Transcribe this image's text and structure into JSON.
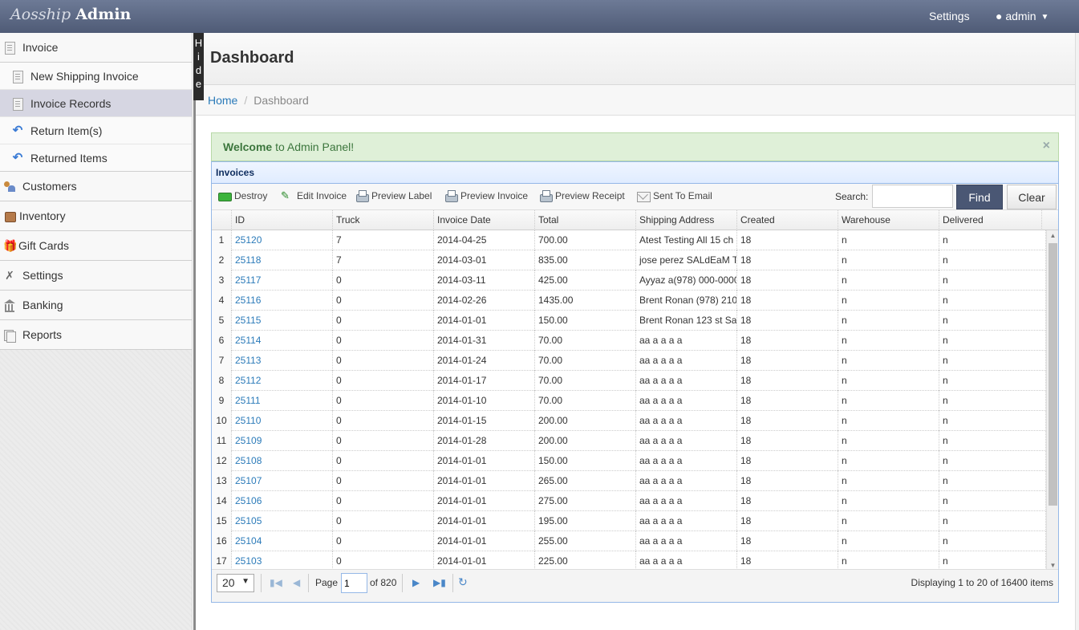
{
  "brand": {
    "part1": "Aosship",
    "part2": "Admin"
  },
  "topnav": {
    "settings": "Settings",
    "user": "admin"
  },
  "sidebar": {
    "invoice": "Invoice",
    "invoice_items": [
      {
        "label": "New Shipping Invoice",
        "icon": "new-invoice-icon"
      },
      {
        "label": "Invoice Records",
        "icon": "document-icon",
        "active": true
      },
      {
        "label": "Return Item(s)",
        "icon": "return-icon"
      },
      {
        "label": "Returned Items",
        "icon": "return-icon"
      }
    ],
    "groups": [
      {
        "label": "Customers",
        "icon": "customers-icon"
      },
      {
        "label": "Inventory",
        "icon": "inventory-icon"
      },
      {
        "label": "Gift Cards",
        "icon": "gift-icon"
      },
      {
        "label": "Settings",
        "icon": "settings-tools-icon"
      },
      {
        "label": "Banking",
        "icon": "bank-icon"
      },
      {
        "label": "Reports",
        "icon": "reports-icon"
      }
    ],
    "hide_label": [
      "H",
      "i",
      "d",
      "e"
    ]
  },
  "page": {
    "title": "Dashboard"
  },
  "breadcrumb": {
    "home": "Home",
    "current": "Dashboard"
  },
  "alert": {
    "strong": "Welcome",
    "text": "to Admin Panel!",
    "close": "×"
  },
  "panel": {
    "title": "Invoices"
  },
  "toolbar": {
    "destroy": "Destroy",
    "edit_invoice": "Edit Invoice",
    "preview_label": "Preview Label",
    "preview_invoice": "Preview Invoice",
    "preview_receipt": "Preview Receipt",
    "sent_to_email": "Sent To Email",
    "search_label": "Search:",
    "search_value": "",
    "find": "Find",
    "clear": "Clear"
  },
  "table": {
    "columns": [
      "ID",
      "Truck",
      "Invoice Date",
      "Total",
      "Shipping Address",
      "Created",
      "Warehouse",
      "Delivered"
    ],
    "rows": [
      {
        "n": "1",
        "id": "25120",
        "truck": "7",
        "date": "2014-04-25",
        "total": "700.00",
        "address": "Atest Testing All 15 ch",
        "created": "18",
        "warehouse": "n",
        "delivered": "n"
      },
      {
        "n": "2",
        "id": "25118",
        "truck": "7",
        "date": "2014-03-01",
        "total": "835.00",
        "address": "jose perez SALdEaM T",
        "created": "18",
        "warehouse": "n",
        "delivered": "n"
      },
      {
        "n": "3",
        "id": "25117",
        "truck": "0",
        "date": "2014-03-11",
        "total": "425.00",
        "address": "Ayyaz a(978) 000-0000",
        "created": "18",
        "warehouse": "n",
        "delivered": "n"
      },
      {
        "n": "4",
        "id": "25116",
        "truck": "0",
        "date": "2014-02-26",
        "total": "1435.00",
        "address": "Brent Ronan (978) 210",
        "created": "18",
        "warehouse": "n",
        "delivered": "n"
      },
      {
        "n": "5",
        "id": "25115",
        "truck": "0",
        "date": "2014-01-01",
        "total": "150.00",
        "address": "Brent Ronan 123 st Sa",
        "created": "18",
        "warehouse": "n",
        "delivered": "n"
      },
      {
        "n": "6",
        "id": "25114",
        "truck": "0",
        "date": "2014-01-31",
        "total": "70.00",
        "address": "aa a a a a",
        "created": "18",
        "warehouse": "n",
        "delivered": "n"
      },
      {
        "n": "7",
        "id": "25113",
        "truck": "0",
        "date": "2014-01-24",
        "total": "70.00",
        "address": "aa a a a a",
        "created": "18",
        "warehouse": "n",
        "delivered": "n"
      },
      {
        "n": "8",
        "id": "25112",
        "truck": "0",
        "date": "2014-01-17",
        "total": "70.00",
        "address": "aa a a a a",
        "created": "18",
        "warehouse": "n",
        "delivered": "n"
      },
      {
        "n": "9",
        "id": "25111",
        "truck": "0",
        "date": "2014-01-10",
        "total": "70.00",
        "address": "aa a a a a",
        "created": "18",
        "warehouse": "n",
        "delivered": "n"
      },
      {
        "n": "10",
        "id": "25110",
        "truck": "0",
        "date": "2014-01-15",
        "total": "200.00",
        "address": "aa a a a a",
        "created": "18",
        "warehouse": "n",
        "delivered": "n"
      },
      {
        "n": "11",
        "id": "25109",
        "truck": "0",
        "date": "2014-01-28",
        "total": "200.00",
        "address": "aa a a a a",
        "created": "18",
        "warehouse": "n",
        "delivered": "n"
      },
      {
        "n": "12",
        "id": "25108",
        "truck": "0",
        "date": "2014-01-01",
        "total": "150.00",
        "address": "aa a a a a",
        "created": "18",
        "warehouse": "n",
        "delivered": "n"
      },
      {
        "n": "13",
        "id": "25107",
        "truck": "0",
        "date": "2014-01-01",
        "total": "265.00",
        "address": "aa a a a a",
        "created": "18",
        "warehouse": "n",
        "delivered": "n"
      },
      {
        "n": "14",
        "id": "25106",
        "truck": "0",
        "date": "2014-01-01",
        "total": "275.00",
        "address": "aa a a a a",
        "created": "18",
        "warehouse": "n",
        "delivered": "n"
      },
      {
        "n": "15",
        "id": "25105",
        "truck": "0",
        "date": "2014-01-01",
        "total": "195.00",
        "address": "aa a a a a",
        "created": "18",
        "warehouse": "n",
        "delivered": "n"
      },
      {
        "n": "16",
        "id": "25104",
        "truck": "0",
        "date": "2014-01-01",
        "total": "255.00",
        "address": "aa a a a a",
        "created": "18",
        "warehouse": "n",
        "delivered": "n"
      },
      {
        "n": "17",
        "id": "25103",
        "truck": "0",
        "date": "2014-01-01",
        "total": "225.00",
        "address": "aa a a a a",
        "created": "18",
        "warehouse": "n",
        "delivered": "n"
      }
    ]
  },
  "pager": {
    "page_size": "20",
    "page_label": "Page",
    "page_value": "1",
    "of_label": "of 820",
    "display": "Displaying 1 to 20 of 16400 items"
  },
  "colors": {
    "topbar": "#5a6682",
    "find_button": "#4a5774",
    "link": "#2a7ab9",
    "alert_bg": "#dff0d8",
    "panel_border": "#95b8e7"
  }
}
